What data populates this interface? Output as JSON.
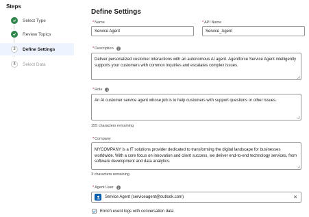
{
  "sidebar": {
    "title": "Steps",
    "steps": [
      {
        "label": "Select Type",
        "status": "complete",
        "icon": "check-icon"
      },
      {
        "label": "Review Topics",
        "status": "complete",
        "icon": "check-icon"
      },
      {
        "label": "Define Settings",
        "status": "current",
        "number": "3"
      },
      {
        "label": "Select Data",
        "status": "upcoming",
        "number": "4"
      }
    ]
  },
  "main": {
    "heading": "Define Settings",
    "name": {
      "label": "Name",
      "value": "Service Agent"
    },
    "api_name": {
      "label": "API Name",
      "value": "Service_Agent"
    },
    "description": {
      "label": "Description",
      "value": "Deliver personalized customer interactions with an autonomous AI agent. Agentforce Service Agent intelligently supports your customers with common inquiries and escalates complex issues."
    },
    "role": {
      "label": "Role",
      "value": "An AI customer service agent whose job is to help customers with support questions or other issues.",
      "help": "155 characters remaining"
    },
    "company": {
      "label": "Company",
      "value": "MYCOMPANY is a IT solutions provider dedicated to transforming the digital landscape for businesses worldwide. With a core focus on innovation and client success, we deliver end-to-end technology services, from software development and data analytics.",
      "help": "3 characters remaining"
    },
    "agent_user": {
      "label": "Agent User",
      "value": "Service Agent (serviceagent@outlook.com)"
    },
    "enrich_checkbox": {
      "label": "Enrich event logs with conversation data",
      "checked": true
    }
  },
  "colors": {
    "accent": "#0176d3",
    "success": "#2e844a",
    "required": "#ba0517",
    "active_bg": "#eef4ff"
  }
}
